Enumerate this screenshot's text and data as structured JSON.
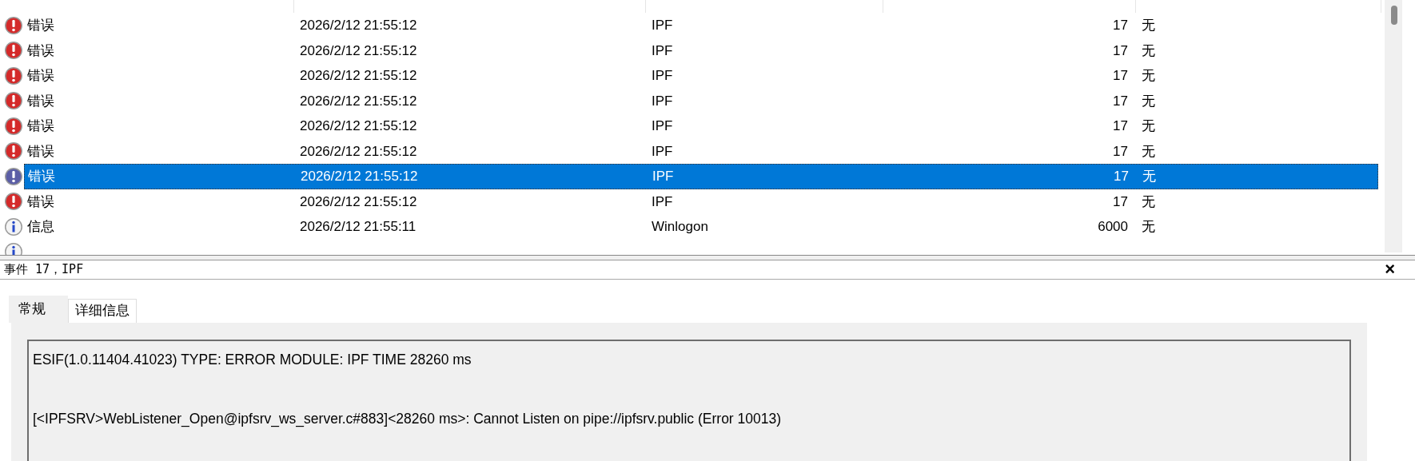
{
  "event_list": {
    "rows": [
      {
        "kind": "error",
        "level": "错误",
        "date_time": "2026/2/12 21:55:12",
        "source": "IPF",
        "event_id": "17",
        "task_category": "无",
        "selected": false
      },
      {
        "kind": "error",
        "level": "错误",
        "date_time": "2026/2/12 21:55:12",
        "source": "IPF",
        "event_id": "17",
        "task_category": "无",
        "selected": false
      },
      {
        "kind": "error",
        "level": "错误",
        "date_time": "2026/2/12 21:55:12",
        "source": "IPF",
        "event_id": "17",
        "task_category": "无",
        "selected": false
      },
      {
        "kind": "error",
        "level": "错误",
        "date_time": "2026/2/12 21:55:12",
        "source": "IPF",
        "event_id": "17",
        "task_category": "无",
        "selected": false
      },
      {
        "kind": "error",
        "level": "错误",
        "date_time": "2026/2/12 21:55:12",
        "source": "IPF",
        "event_id": "17",
        "task_category": "无",
        "selected": false
      },
      {
        "kind": "error",
        "level": "错误",
        "date_time": "2026/2/12 21:55:12",
        "source": "IPF",
        "event_id": "17",
        "task_category": "无",
        "selected": false
      },
      {
        "kind": "error",
        "level": "错误",
        "date_time": "2026/2/12 21:55:12",
        "source": "IPF",
        "event_id": "17",
        "task_category": "无",
        "selected": true
      },
      {
        "kind": "error",
        "level": "错误",
        "date_time": "2026/2/12 21:55:12",
        "source": "IPF",
        "event_id": "17",
        "task_category": "无",
        "selected": false
      },
      {
        "kind": "info",
        "level": "信息",
        "date_time": "2026/2/12 21:55:11",
        "source": "Winlogon",
        "event_id": "6000",
        "task_category": "无",
        "selected": false
      },
      {
        "kind": "info",
        "selected": false
      }
    ]
  },
  "detail": {
    "title": "事件 17，IPF",
    "close": "×",
    "tabs": [
      {
        "label": "常规",
        "selected": true
      },
      {
        "label": "详细信息",
        "selected": false
      }
    ],
    "lines": [
      "ESIF(1.0.11404.41023) TYPE: ERROR MODULE: IPF TIME 28260 ms",
      "[<IPFSRV>WebListener_Open@ipfsrv_ws_server.c#883]<28260 ms>: Cannot Listen on pipe://ipfsrv.public (Error 10013)"
    ]
  }
}
